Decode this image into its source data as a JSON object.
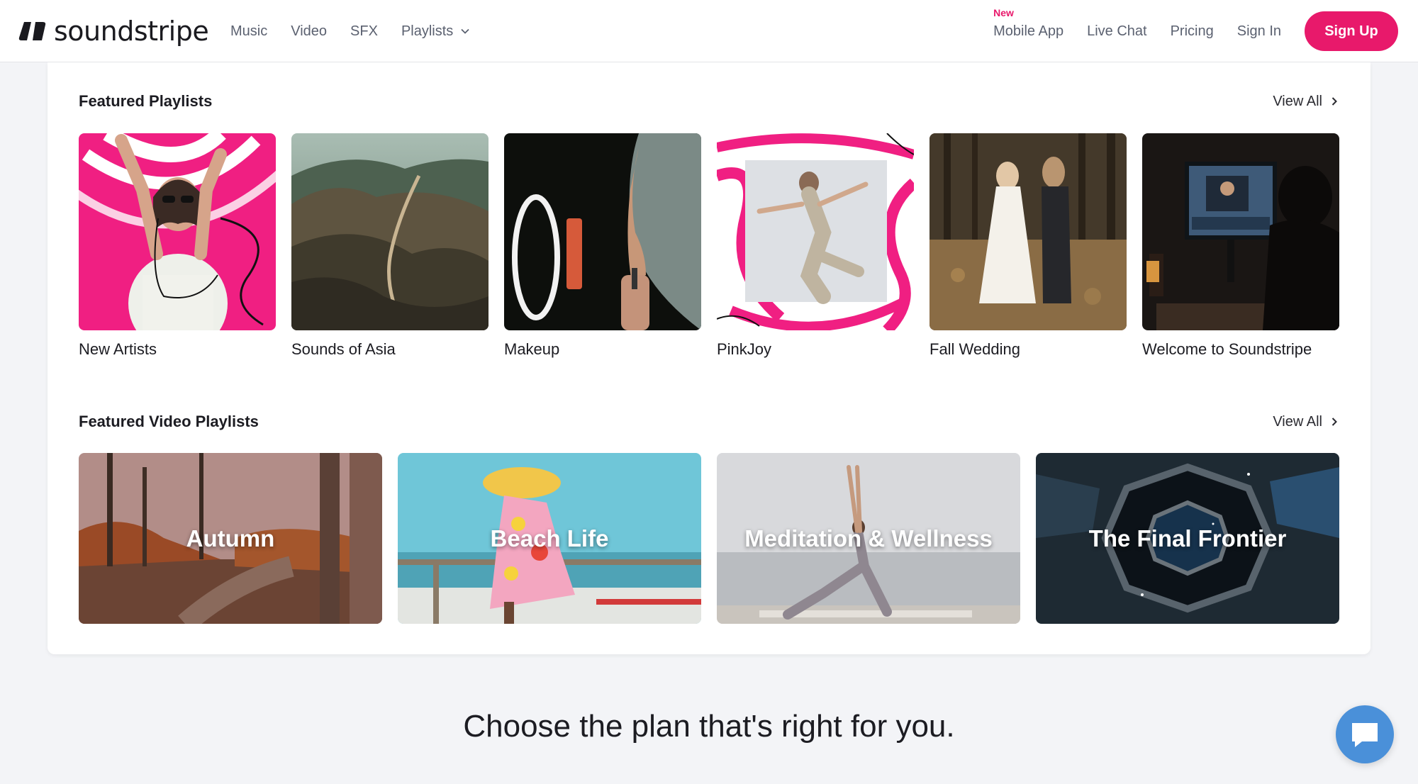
{
  "header": {
    "logo_text": "soundstripe",
    "nav_left": [
      "Music",
      "Video",
      "SFX",
      "Playlists"
    ],
    "new_badge": "New",
    "mobile_app": "Mobile App",
    "live_chat": "Live Chat",
    "pricing": "Pricing",
    "sign_in": "Sign In",
    "sign_up": "Sign Up",
    "accent_color": "#e8196b"
  },
  "featured_playlists": {
    "title": "Featured Playlists",
    "view_all": "View All",
    "items": [
      {
        "label": "New Artists"
      },
      {
        "label": "Sounds of Asia"
      },
      {
        "label": "Makeup"
      },
      {
        "label": "PinkJoy"
      },
      {
        "label": "Fall Wedding"
      },
      {
        "label": "Welcome to Soundstripe"
      }
    ]
  },
  "featured_video_playlists": {
    "title": "Featured Video Playlists",
    "view_all": "View All",
    "items": [
      {
        "label": "Autumn"
      },
      {
        "label": "Beach Life"
      },
      {
        "label": "Meditation & Wellness"
      },
      {
        "label": "The Final Frontier"
      }
    ]
  },
  "pricing_heading": "Choose the plan that's right for you.",
  "chat_widget": {
    "icon": "chat-icon",
    "color": "#4a90d9"
  }
}
